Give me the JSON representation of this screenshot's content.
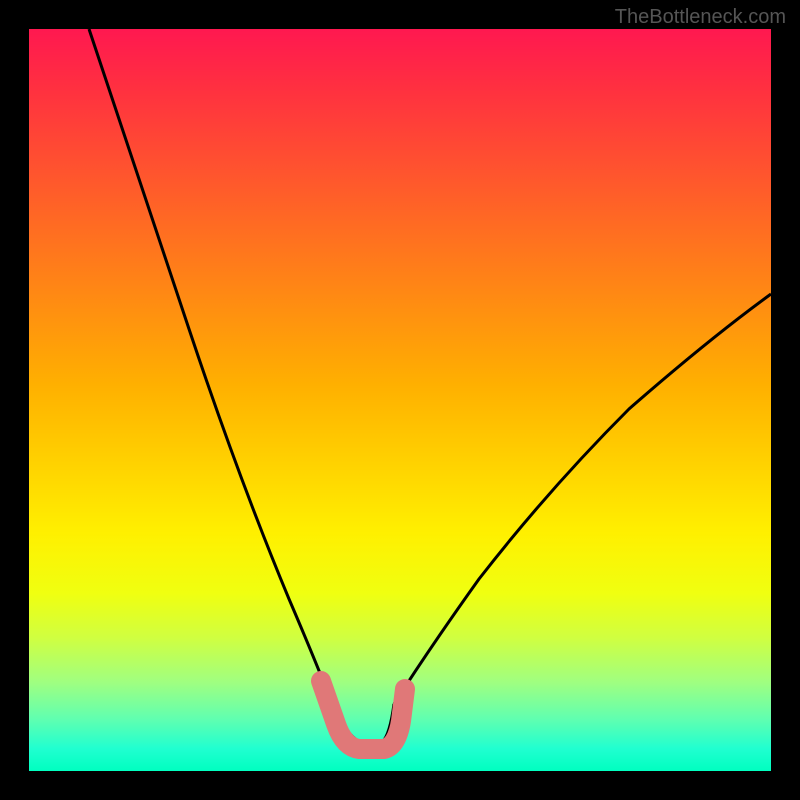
{
  "watermark": "TheBottleneck.com",
  "chart_data": {
    "type": "line",
    "title": "",
    "xlabel": "",
    "ylabel": "",
    "xlim": [
      0,
      100
    ],
    "ylim": [
      0,
      100
    ],
    "series": [
      {
        "name": "bottleneck-curve",
        "x": [
          10,
          15,
          20,
          25,
          30,
          35,
          38,
          40,
          42,
          44,
          46,
          48,
          50,
          55,
          60,
          65,
          70,
          75,
          80,
          85,
          90,
          95,
          100
        ],
        "y": [
          100,
          85,
          70,
          55,
          40,
          25,
          15,
          8,
          3,
          1,
          1,
          2,
          4,
          10,
          18,
          26,
          33,
          40,
          46,
          52,
          57,
          62,
          66
        ]
      }
    ],
    "annotations": [
      {
        "name": "optimal-region-marker",
        "type": "segment",
        "points": [
          {
            "x": 38,
            "y": 15
          },
          {
            "x": 40,
            "y": 6
          },
          {
            "x": 44,
            "y": 2
          },
          {
            "x": 48,
            "y": 2
          },
          {
            "x": 50,
            "y": 6
          },
          {
            "x": 51,
            "y": 12
          }
        ],
        "color": "#e07878",
        "width": 18
      }
    ],
    "background_gradient": {
      "top_color": "#ff1850",
      "bottom_color": "#00ffc0"
    }
  }
}
